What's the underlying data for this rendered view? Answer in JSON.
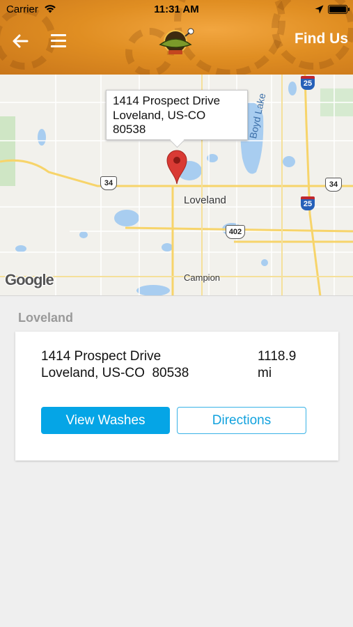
{
  "status_bar": {
    "carrier": "Carrier",
    "time": "11:31 AM",
    "wifi_icon": "wifi-icon",
    "location_icon": "location-arrow-icon",
    "battery_icon": "battery-icon"
  },
  "header": {
    "back_icon": "back-arrow-icon",
    "menu_icon": "hamburger-menu-icon",
    "logo_icon": "steampunk-logo-icon",
    "title": "Find Us",
    "accent_color": "#e38f26"
  },
  "map": {
    "callout": {
      "line1": "1414 Prospect Drive",
      "line2": "Loveland, US-CO",
      "line3": "80538"
    },
    "labels": {
      "town": "Loveland",
      "town2": "Campion",
      "lake": "Boyd Lake",
      "attribution": "Google"
    },
    "shields": {
      "us34_left": "34",
      "us34_right": "34",
      "i25_top": "25",
      "i25_mid": "25",
      "co402": "402"
    },
    "pin_icon": "map-pin-icon",
    "pin_color": "#d93a34"
  },
  "location": {
    "city": "Loveland",
    "address_line1": "1414 Prospect Drive",
    "address_line2": "Loveland, US-CO  80538",
    "distance_value": "1118.9",
    "distance_unit": "mi"
  },
  "actions": {
    "view_washes": "View Washes",
    "directions": "Directions",
    "primary_color": "#05a5e6"
  }
}
